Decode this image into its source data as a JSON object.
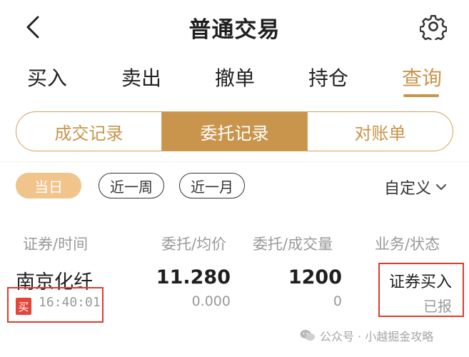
{
  "header": {
    "title": "普通交易"
  },
  "tabs": [
    {
      "label": "买入"
    },
    {
      "label": "卖出"
    },
    {
      "label": "撤单"
    },
    {
      "label": "持仓"
    },
    {
      "label": "查询"
    }
  ],
  "active_tab": "查询",
  "segments": [
    {
      "label": "成交记录"
    },
    {
      "label": "委托记录"
    },
    {
      "label": "对账单"
    }
  ],
  "active_segment": "委托记录",
  "filters": {
    "chips": [
      {
        "label": "当日"
      },
      {
        "label": "近一周"
      },
      {
        "label": "近一月"
      }
    ],
    "active_chip": "当日",
    "custom_label": "自定义"
  },
  "columns": [
    "证券/时间",
    "委托/均价",
    "委托/成交量",
    "业务/状态"
  ],
  "orders": [
    {
      "name": "南京化纤",
      "side": "买",
      "time": "16:40:01",
      "price": "11.280",
      "avg_price": "0.000",
      "quantity": "1200",
      "filled": "0",
      "business": "证券买入",
      "status": "已报"
    }
  ],
  "watermark": "公众号 · 小越掘金攻略",
  "colors": {
    "accent": "#c7944a",
    "chip_active": "#f0c48a",
    "buy_badge": "#e2463a",
    "highlight": "#e23a2d"
  },
  "icons": [
    "back-arrow-icon",
    "gear-icon",
    "chevron-down-icon",
    "wechat-icon"
  ]
}
